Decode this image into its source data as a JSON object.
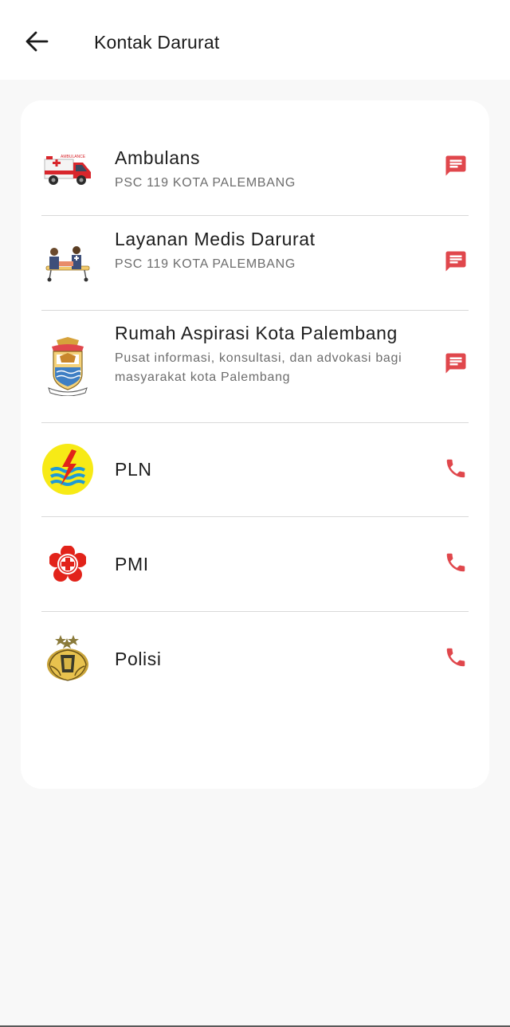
{
  "header": {
    "back_icon": "arrow-left-icon",
    "title": "Kontak Darurat"
  },
  "accent_color": "#e0474c",
  "contacts": [
    {
      "name": "Ambulans",
      "subtitle": "PSC 119 KOTA PALEMBANG",
      "logo": "ambulance-logo",
      "action_icon": "message-icon"
    },
    {
      "name": "Layanan Medis Darurat",
      "subtitle": "PSC 119 KOTA PALEMBANG",
      "logo": "paramedic-logo",
      "action_icon": "message-icon"
    },
    {
      "name": "Rumah Aspirasi Kota Palembang",
      "subtitle": "Pusat informasi, konsultasi, dan advokasi bagi masyarakat kota Palembang",
      "logo": "palembang-emblem-logo",
      "action_icon": "message-icon"
    },
    {
      "name": "PLN",
      "subtitle": "",
      "logo": "pln-logo",
      "action_icon": "phone-icon"
    },
    {
      "name": "PMI",
      "subtitle": "",
      "logo": "pmi-logo",
      "action_icon": "phone-icon"
    },
    {
      "name": "Polisi",
      "subtitle": "",
      "logo": "polri-emblem-logo",
      "action_icon": "phone-icon"
    }
  ]
}
